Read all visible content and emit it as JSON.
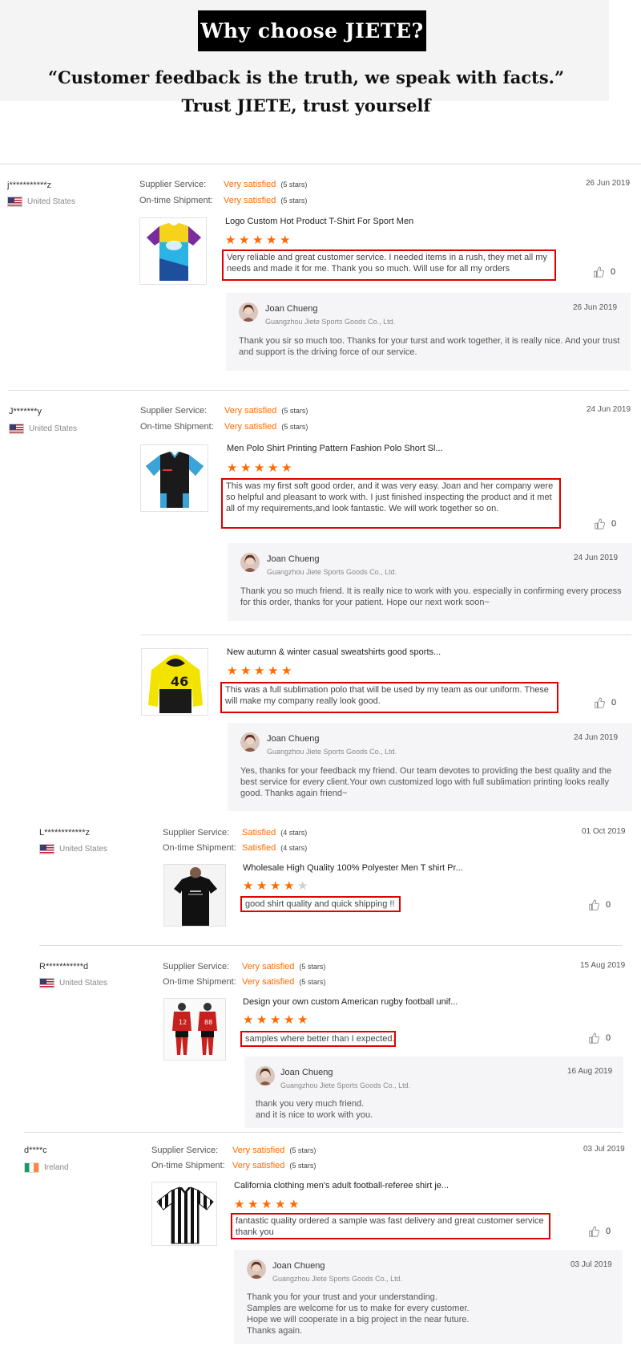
{
  "header": {
    "title": "Why choose JIETE?",
    "quote": "“Customer feedback is the truth, we speak with facts.”",
    "tagline": "Trust JIETE, trust yourself"
  },
  "labels": {
    "supplier_service": "Supplier Service:",
    "ontime_shipment": "On-time Shipment:",
    "seller_name": "Joan Chueng",
    "seller_company": "Guangzhou Jiete Sports Goods Co., Ltd."
  },
  "colors": {
    "accent": "#ff6a00",
    "highlight_border": "#e00000"
  },
  "reviews": [
    {
      "user": "j***********z",
      "country": "United States",
      "date": "26 Jun 2019",
      "supplier_rating": "Very satisfied",
      "supplier_stars": "(5 stars)",
      "shipment_rating": "Very satisfied",
      "shipment_stars": "(5 stars)",
      "items": [
        {
          "product": "Logo Custom Hot Product T-Shirt For Sport Men",
          "stars": 5,
          "comment": "Very reliable and great customer service. I needed items in a rush, they met all my needs and made it for me. Thank you so much. Will use for all my orders",
          "likes": "0",
          "reply": {
            "date": "26 Jun 2019",
            "text": "Thank you sir so much too. Thanks for your turst and work together, it is really nice. And your trust and support is the driving force of our service."
          }
        }
      ]
    },
    {
      "user": "J*******y",
      "country": "United States",
      "date": "24 Jun 2019",
      "supplier_rating": "Very satisfied",
      "supplier_stars": "(5 stars)",
      "shipment_rating": "Very satisfied",
      "shipment_stars": "(5 stars)",
      "items": [
        {
          "product": "Men Polo Shirt Printing Pattern Fashion Polo Short Sl...",
          "stars": 5,
          "comment": "This was my first soft good order, and it was very easy. Joan and her company were so helpful and pleasant to work with. I just finished inspecting the product and it met all of my requirements,and look fantastic. We will work together so on.",
          "likes": "0",
          "reply": {
            "date": "24 Jun 2019",
            "text": "Thank you so much friend. It is really nice to work with you. especially in confirming every process for this order, thanks for your patient. Hope our next work soon~"
          }
        },
        {
          "product": "New autumn & winter casual sweatshirts good sports...",
          "stars": 5,
          "comment": "This was a full sublimation polo that will be used by my team as our uniform. These will make my company really look good.",
          "likes": "0",
          "reply": {
            "date": "24 Jun 2019",
            "text": "Yes, thanks for your feedback my friend. Our team devotes to providing the best quality and the best service for every client.Your own customized logo with full sublimation printing looks really good. Thanks again friend~"
          }
        }
      ]
    },
    {
      "user": "L************z",
      "country": "United States",
      "date": "01 Oct 2019",
      "supplier_rating": "Satisfied",
      "supplier_stars": "(4 stars)",
      "shipment_rating": "Satisfied",
      "shipment_stars": "(4 stars)",
      "items": [
        {
          "product": "Wholesale High Quality 100% Polyester Men T shirt Pr...",
          "stars": 4,
          "comment": "good shirt quality and quick shipping !!",
          "likes": "0"
        }
      ]
    },
    {
      "user": "R***********d",
      "country": "United States",
      "date": "15 Aug 2019",
      "supplier_rating": "Very satisfied",
      "supplier_stars": "(5 stars)",
      "shipment_rating": "Very satisfied",
      "shipment_stars": "(5 stars)",
      "items": [
        {
          "product": "Design your own custom American rugby football unif...",
          "stars": 5,
          "comment": "samples where better than I expected.",
          "likes": "0",
          "reply": {
            "date": "16 Aug 2019",
            "text": "thank you very much friend.\nand it is nice to work with you."
          }
        }
      ]
    },
    {
      "user": "d****c",
      "country": "Ireland",
      "date": "03 Jul 2019",
      "supplier_rating": "Very satisfied",
      "supplier_stars": "(5 stars)",
      "shipment_rating": "Very satisfied",
      "shipment_stars": "(5 stars)",
      "items": [
        {
          "product": "California clothing men's adult football-referee shirt je...",
          "stars": 5,
          "comment": "fantastic quality ordered a sample was fast delivery and great customer service thank you",
          "likes": "0",
          "reply": {
            "date": "03 Jul 2019",
            "text": "Thank you for your trust and your understanding.\nSamples are welcome for us to make for every customer.\nHope we will cooperate in a big project in the near future.\nThanks again."
          }
        }
      ]
    }
  ]
}
